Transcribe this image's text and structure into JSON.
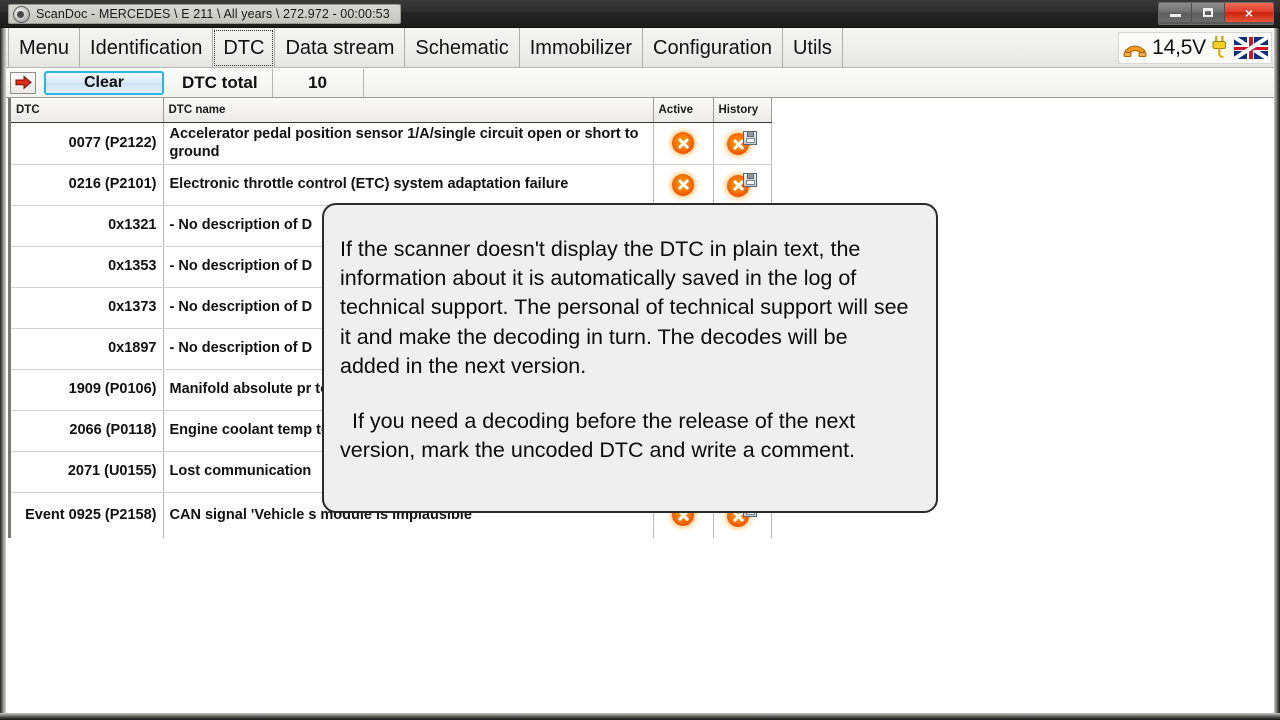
{
  "window": {
    "title": "ScanDoc - MERCEDES \\ E 211 \\ All years \\ 272.972 - 00:00:53",
    "icon": "scandoc-logo-icon",
    "minimize_label": "",
    "maximize_label": "",
    "close_label": "×"
  },
  "tabs": [
    {
      "label": "Menu",
      "active": false
    },
    {
      "label": "Identification",
      "active": false
    },
    {
      "label": "DTC",
      "active": true
    },
    {
      "label": "Data stream",
      "active": false
    },
    {
      "label": "Schematic",
      "active": false
    },
    {
      "label": "Immobilizer",
      "active": false
    },
    {
      "label": "Configuration",
      "active": false
    },
    {
      "label": "Utils",
      "active": false
    }
  ],
  "status": {
    "phone_icon": "telephone-icon",
    "voltage": "14,5V",
    "plug_icon": "power-plug-icon",
    "flag": "uk-flag-icon"
  },
  "toolbar": {
    "back_icon": "back-arrow-icon",
    "clear_label": "Clear",
    "dtc_total_label": "DTC total",
    "dtc_total_value": "10"
  },
  "table": {
    "headers": {
      "dtc": "DTC",
      "name": "DTC name",
      "active": "Active",
      "history": "History"
    },
    "rows": [
      {
        "dtc": "0077 (P2122)",
        "name": "Accelerator pedal position sensor 1/A/single circuit open or short to ground",
        "active": true,
        "history": true
      },
      {
        "dtc": "0216 (P2101)",
        "name": "Electronic throttle control (ETC) system adaptation failure",
        "active": true,
        "history": true
      },
      {
        "dtc": "0x1321",
        "name": "- No description of D",
        "active": true,
        "history": true
      },
      {
        "dtc": "0x1353",
        "name": "- No description of D",
        "active": true,
        "history": true
      },
      {
        "dtc": "0x1373",
        "name": "- No description of D",
        "active": true,
        "history": true
      },
      {
        "dtc": "0x1897",
        "name": "- No description of D",
        "active": true,
        "history": true
      },
      {
        "dtc": "1909 (P0106)",
        "name": "Manifold absolute pr to battery",
        "active": true,
        "history": true
      },
      {
        "dtc": "2066 (P0118)",
        "name": "Engine coolant temp to battery",
        "active": true,
        "history": true
      },
      {
        "dtc": "2071 (U0155)",
        "name": "Lost communication",
        "active": true,
        "history": true
      },
      {
        "dtc": "Event 0925 (P2158)",
        "name": "CAN signal 'Vehicle s module is implausible",
        "active": true,
        "history": true
      }
    ]
  },
  "tooltip": {
    "paragraph1": "If the scanner doesn't display the DTC in plain text, the information about it is automatically saved in the log of technical support. The personal of technical support will see it and make the decoding in turn. The decodes will be added in the next version.",
    "paragraph2": "If you need a decoding before the release of the next version, mark the uncoded DTC and write a comment."
  },
  "colors": {
    "accent_focus": "#29b6e8",
    "error_icon": "#f7720a",
    "close_button": "#e03a22",
    "titlebar": "#2c2c2c"
  }
}
